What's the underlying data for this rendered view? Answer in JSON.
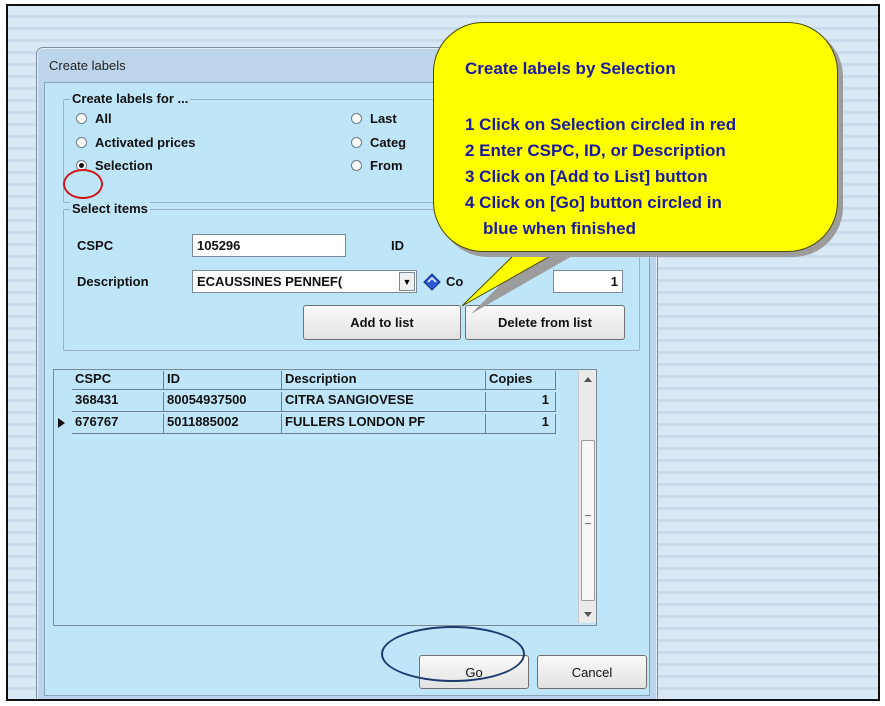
{
  "dialog": {
    "title": "Create labels",
    "create_for": {
      "legend": "Create labels for ...",
      "options": [
        "All",
        "Activated prices",
        "Selection",
        "Last",
        "Categ",
        "From"
      ],
      "selected": "Selection"
    },
    "select_items": {
      "legend": "Select items",
      "cspc_label": "CSPC",
      "cspc_value": "105296",
      "id_label": "ID",
      "description_label": "Description",
      "description_value": "ECAUSSINES PENNEF(",
      "copies_label": "Co",
      "copies_value": "1",
      "add_button": "Add to list",
      "delete_button": "Delete from list"
    },
    "grid": {
      "headers": [
        "CSPC",
        "ID",
        "Description",
        "Copies"
      ],
      "rows": [
        {
          "cspc": "368431",
          "id": "80054937500",
          "description": "CITRA SANGIOVESE",
          "copies": "1"
        },
        {
          "cspc": "676767",
          "id": "5011885002",
          "description": "FULLERS LONDON PF",
          "copies": "1"
        }
      ],
      "current_row": 1
    },
    "go_button": "Go",
    "cancel_button": "Cancel"
  },
  "callout": {
    "title": "Create labels by Selection",
    "steps": [
      "1 Click on Selection circled in red",
      "2 Enter CSPC, ID, or Description",
      "3 Click on [Add to List] button",
      "4 Click on [Go] button circled in",
      "blue when finished"
    ]
  },
  "colors": {
    "callout_fill": "#ffff00",
    "callout_text": "#1a1aa0",
    "highlight_red": "#d01818",
    "highlight_blue": "#1c3a6e"
  }
}
